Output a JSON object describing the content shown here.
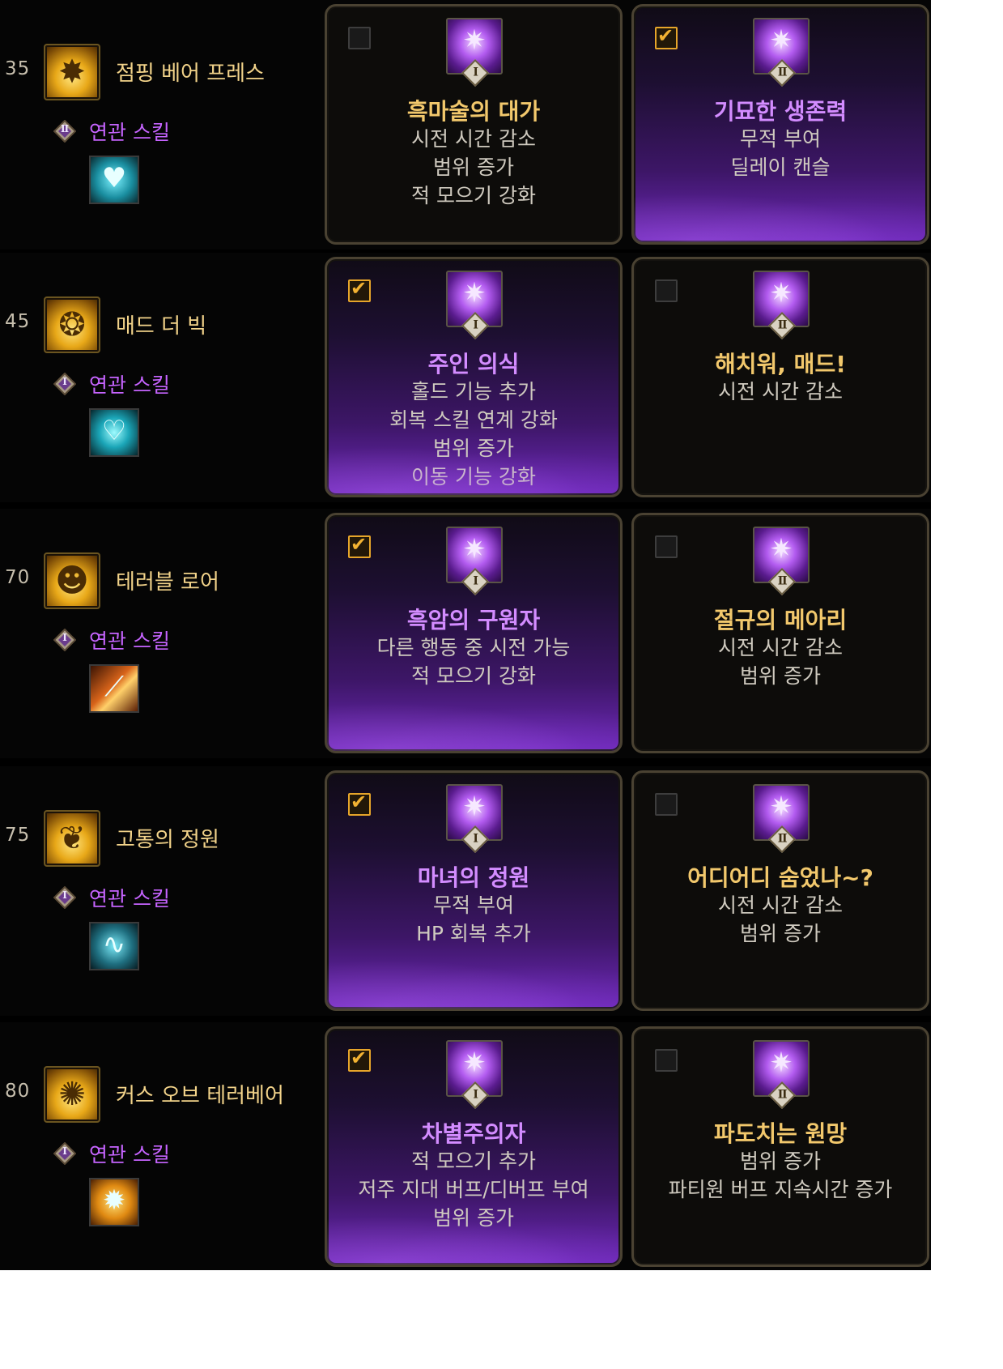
{
  "colors": {
    "selected_title": "#d38cff",
    "unselected_title": "#f2c86c",
    "related_label": "#c664ff",
    "checkbox_on": "#f2b232"
  },
  "rows": [
    {
      "level": "35",
      "skill_name": "점핑 베어 프레스",
      "skill_icon": "explosion-icon",
      "related_rank": "Ⅱ",
      "related_label": "연관 스킬",
      "related_icon": "hearts-icon",
      "options": [
        {
          "rank": "Ⅰ",
          "checked": false,
          "title": "흑마술의 대가",
          "effects": [
            "시전 시간 감소",
            "범위 증가",
            "적 모으기 강화"
          ]
        },
        {
          "rank": "Ⅱ",
          "checked": true,
          "title": "기묘한 생존력",
          "effects": [
            "무적 부여",
            "딜레이 캔슬"
          ]
        }
      ]
    },
    {
      "level": "45",
      "skill_name": "매드 더 빅",
      "skill_icon": "bear-face-icon",
      "related_rank": "Ⅰ",
      "related_label": "연관 스킬",
      "related_icon": "heart-shield-icon",
      "options": [
        {
          "rank": "Ⅰ",
          "checked": true,
          "title": "주인 의식",
          "effects": [
            "홀드 기능 추가",
            "회복 스킬 연계 강화",
            "범위 증가",
            "이동 기능 강화"
          ]
        },
        {
          "rank": "Ⅱ",
          "checked": false,
          "title": "해치워, 매드!",
          "effects": [
            "시전 시간 감소"
          ]
        }
      ]
    },
    {
      "level": "70",
      "skill_name": "테러블 로어",
      "skill_icon": "roaring-bear-icon",
      "related_rank": "Ⅰ",
      "related_label": "연관 스킬",
      "related_icon": "claw-slash-icon",
      "options": [
        {
          "rank": "Ⅰ",
          "checked": true,
          "title": "흑암의 구원자",
          "effects": [
            "다른 행동 중 시전 가능",
            "적 모으기 강화"
          ]
        },
        {
          "rank": "Ⅱ",
          "checked": false,
          "title": "절규의 메아리",
          "effects": [
            "시전 시간 감소",
            "범위 증가"
          ]
        }
      ]
    },
    {
      "level": "75",
      "skill_name": "고통의 정원",
      "skill_icon": "thorn-garden-icon",
      "related_rank": "Ⅰ",
      "related_label": "연관 스킬",
      "related_icon": "whip-icon",
      "options": [
        {
          "rank": "Ⅰ",
          "checked": true,
          "title": "마녀의 정원",
          "effects": [
            "무적 부여",
            "HP 회복 추가"
          ]
        },
        {
          "rank": "Ⅱ",
          "checked": false,
          "title": "어디어디 숨었나~?",
          "effects": [
            "시전 시간 감소",
            "범위 증가"
          ]
        }
      ]
    },
    {
      "level": "80",
      "skill_name": "커스 오브 테러베어",
      "skill_icon": "cursed-bear-icon",
      "related_rank": "Ⅰ",
      "related_label": "연관 스킬",
      "related_icon": "bear-burst-icon",
      "options": [
        {
          "rank": "Ⅰ",
          "checked": true,
          "title": "차별주의자",
          "effects": [
            "적 모으기 추가",
            "저주 지대 버프/디버프 부여",
            "범위 증가"
          ]
        },
        {
          "rank": "Ⅱ",
          "checked": false,
          "title": "파도치는 원망",
          "effects": [
            "범위 증가",
            "파티원 버프 지속시간 증가"
          ]
        }
      ]
    }
  ]
}
